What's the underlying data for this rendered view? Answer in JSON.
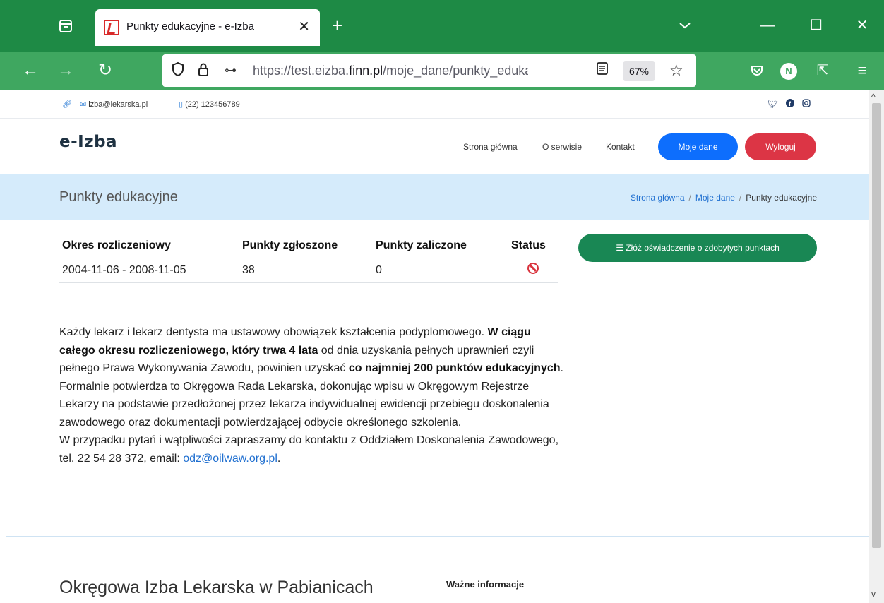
{
  "browser": {
    "tab_title": "Punkty edukacyjne - e-Izba",
    "tab_close": "✕",
    "new_tab": "+",
    "url_prefix": "https://test.eizba.",
    "url_domain": "finn.pl",
    "url_path": "/moje_dane/punkty_edukacyjne",
    "zoom": "67%",
    "window_controls": {
      "minimize": "—",
      "maximize": "☐",
      "close": "✕"
    },
    "profile_initial": "N",
    "accent_color": "#1e8a45",
    "toolbar_color": "#3fa760"
  },
  "contact_bar": {
    "email": "izba@lekarska.pl",
    "phone": "(22) 123456789",
    "social_icons": [
      "twitter-icon",
      "facebook-icon",
      "instagram-icon"
    ]
  },
  "site": {
    "logo": "e-Izba",
    "menu": {
      "home": "Strona główna",
      "about": "O serwisie",
      "contact": "Kontakt",
      "my_data": "Moje dane",
      "logout": "Wyloguj"
    }
  },
  "page_header": {
    "title": "Punkty edukacyjne",
    "breadcrumb": [
      "Strona główna",
      "Moje dane",
      "Punkty edukacyjne"
    ],
    "separator": "/"
  },
  "points_table": {
    "headers": [
      "Okres rozliczeniowy",
      "Punkty zgłoszone",
      "Punkty zaliczone",
      "Status"
    ],
    "rows": [
      {
        "period": "2004-11-06 - 2008-11-05",
        "submitted": "38",
        "accepted": "0",
        "status_icon": "ban-icon"
      }
    ]
  },
  "submit_button": "Złóż oświadczenie o zdobytych punktach",
  "info_text": {
    "p1": "Każdy lekarz i lekarz dentysta ma ustawowy obowiązek kształcenia podyplomowego. ",
    "p1_bold": "W ciągu całego okresu rozliczeniowego, który trwa 4 lata",
    "p2": " od dnia uzyskania pełnych uprawnień czyli pełnego Prawa Wykonywania Zawodu, powinien uzyskać ",
    "p2_bold": "co najmniej 200 punktów edukacyjnych",
    "p3": ". Formalnie potwierdza to Okręgowa Rada Lekarska, dokonując wpisu w Okręgowym Rejestrze Lekarzy na podstawie przedłożonej przez lekarza indywidualnej ewidencji przebiegu doskonalenia zawodowego oraz dokumentacji potwierdzającej odbycie określonego szkolenia.",
    "p4": "W przypadku pytań i wątpliwości zapraszamy do kontaktu z Oddziałem Doskonalenia Zawodowego, tel. 22 54 28 372, email: ",
    "email_link": "odz@oilwaw.org.pl",
    "p4_end": "."
  },
  "footer": {
    "title": "Okręgowa Izba Lekarska w Pabianicach",
    "subtitle": "Ważne informacje"
  }
}
